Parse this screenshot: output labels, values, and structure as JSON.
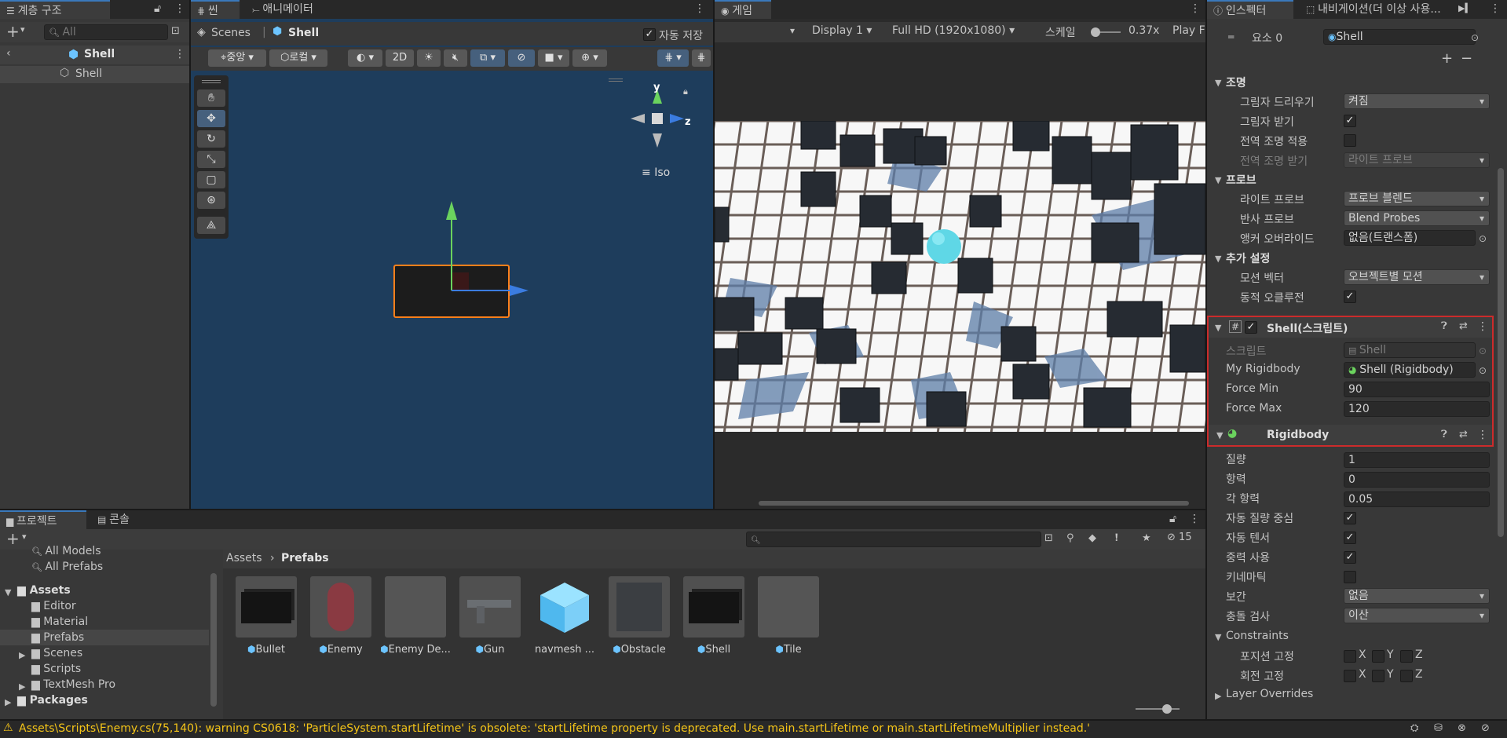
{
  "hierarchy": {
    "tab": "계층 구조",
    "search_placeholder": "All",
    "scene_name": "Shell",
    "items": [
      {
        "label": "Shell"
      }
    ]
  },
  "scene": {
    "tabs": [
      {
        "label": "씬"
      },
      {
        "label": "애니메이터"
      }
    ],
    "breadcrumb_root": "Scenes",
    "breadcrumb_current": "Shell",
    "auto_save_label": "자동 저장",
    "auto_save_checked": "✓",
    "pivot_label": "중앙",
    "local_label": "로컬",
    "mode_2d": "2D",
    "view_label": "Iso",
    "axes": {
      "y": "y",
      "z": "z"
    }
  },
  "game": {
    "tab": "게임",
    "display": "Display 1",
    "resolution": "Full HD (1920x1080)",
    "scale_label": "스케일",
    "scale_value": "0.37x",
    "play_label": "Play F"
  },
  "inspector": {
    "tabs": [
      {
        "label": "인스펙터"
      },
      {
        "label": "내비게이션(더 이상 사용..."
      }
    ],
    "element_label": "요소 0",
    "element_value": "Shell",
    "lighting": {
      "title": "조명",
      "cast_shadows_label": "그림자 드리우기",
      "cast_shadows_value": "켜짐",
      "receive_shadows_label": "그림자 받기",
      "contribute_gi_label": "전역 조명 적용",
      "receive_gi_label": "전역 조명 받기",
      "receive_gi_value": "라이트 프로브"
    },
    "probes": {
      "title": "프로브",
      "light_probes_label": "라이트 프로브",
      "light_probes_value": "프로브 블렌드",
      "reflection_probes_label": "반사 프로브",
      "reflection_probes_value": "Blend Probes",
      "anchor_label": "앵커 오버라이드",
      "anchor_value": "없음(트랜스폼)"
    },
    "additional": {
      "title": "추가 설정",
      "motion_vectors_label": "모션 벡터",
      "motion_vectors_value": "오브젝트별 모션",
      "dynamic_occlusion_label": "동적 오클루전"
    },
    "shell_script": {
      "title": "Shell(스크립트)",
      "script_label": "스크립트",
      "script_value": "Shell",
      "rigidbody_label": "My Rigidbody",
      "rigidbody_value": "Shell (Rigidbody)",
      "force_min_label": "Force Min",
      "force_min_value": "90",
      "force_max_label": "Force Max",
      "force_max_value": "120"
    },
    "rigidbody": {
      "title": "Rigidbody",
      "mass_label": "질량",
      "mass_value": "1",
      "drag_label": "항력",
      "drag_value": "0",
      "angular_drag_label": "각 항력",
      "angular_drag_value": "0.05",
      "auto_com_label": "자동 질량 중심",
      "auto_tensor_label": "자동 텐서",
      "use_gravity_label": "중력 사용",
      "kinematic_label": "키네마틱",
      "interpolate_label": "보간",
      "interpolate_value": "없음",
      "collision_label": "충돌 검사",
      "collision_value": "이산",
      "constraints_label": "Constraints",
      "freeze_pos_label": "포지션 고정",
      "freeze_rot_label": "회전 고정",
      "axis_x": "X",
      "axis_y": "Y",
      "axis_z": "Z",
      "layer_overrides_label": "Layer Overrides"
    },
    "check_mark": "✓"
  },
  "project": {
    "tabs": [
      {
        "label": "프로젝트"
      },
      {
        "label": "콘솔"
      }
    ],
    "hidden_count": "15",
    "tree": [
      {
        "label": "All Models"
      },
      {
        "label": "All Prefabs"
      },
      {
        "label": "Assets"
      },
      {
        "label": "Editor"
      },
      {
        "label": "Material"
      },
      {
        "label": "Prefabs"
      },
      {
        "label": "Scenes"
      },
      {
        "label": "Scripts"
      },
      {
        "label": "TextMesh Pro"
      },
      {
        "label": "Packages"
      }
    ],
    "breadcrumb_root": "Assets",
    "breadcrumb_current": "Prefabs",
    "assets": [
      {
        "label": "Bullet"
      },
      {
        "label": "Enemy"
      },
      {
        "label": "Enemy De..."
      },
      {
        "label": "Gun"
      },
      {
        "label": "navmesh ..."
      },
      {
        "label": "Obstacle"
      },
      {
        "label": "Shell"
      },
      {
        "label": "Tile"
      }
    ]
  },
  "status": {
    "message": "Assets\\Scripts\\Enemy.cs(75,140): warning CS0618: 'ParticleSystem.startLifetime' is obsolete: 'startLifetime property is deprecated. Use main.startLifetime or main.startLifetimeMultiplier instead.'"
  },
  "colors": {
    "scene_bg": "#1e3d5c",
    "selection": "#ff7f1a",
    "highlight_box": "#cc2b2b",
    "warning": "#f5c518"
  }
}
